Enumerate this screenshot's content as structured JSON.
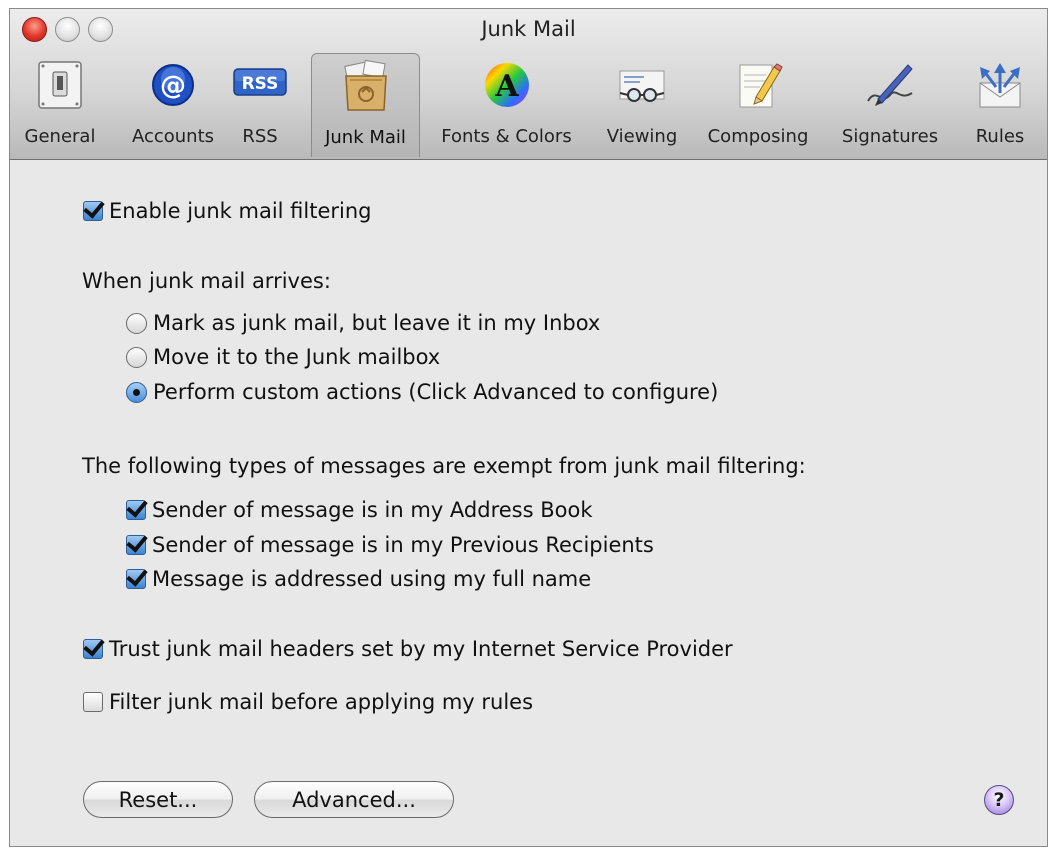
{
  "window": {
    "title": "Junk Mail"
  },
  "toolbar": {
    "items": [
      {
        "label": "General",
        "icon": "switch-icon"
      },
      {
        "label": "Accounts",
        "icon": "at-sign-icon"
      },
      {
        "label": "RSS",
        "icon": "rss-icon"
      },
      {
        "label": "Junk Mail",
        "icon": "junk-mail-bag-icon",
        "selected": true
      },
      {
        "label": "Fonts & Colors",
        "icon": "font-color-wheel-icon"
      },
      {
        "label": "Viewing",
        "icon": "glasses-envelope-icon"
      },
      {
        "label": "Composing",
        "icon": "pencil-paper-icon"
      },
      {
        "label": "Signatures",
        "icon": "pen-signature-icon"
      },
      {
        "label": "Rules",
        "icon": "rules-arrows-icon"
      }
    ],
    "rss_badge": "RSS",
    "fonts_glyph": "A",
    "accounts_glyph": "@"
  },
  "junk": {
    "enable_label": "Enable junk mail filtering",
    "enable_checked": true,
    "arrives_label": "When junk mail arrives:",
    "options": [
      {
        "label": "Mark as junk mail, but leave it in my Inbox",
        "selected": false
      },
      {
        "label": "Move it to the Junk mailbox",
        "selected": false
      },
      {
        "label": "Perform custom actions (Click Advanced to configure)",
        "selected": true
      }
    ],
    "exempt_label": "The following types of messages are exempt from junk mail filtering:",
    "exempt": [
      {
        "label": "Sender of message is in my Address Book",
        "checked": true
      },
      {
        "label": "Sender of message is in my Previous Recipients",
        "checked": true
      },
      {
        "label": "Message is addressed using my full name",
        "checked": true
      }
    ],
    "trust_label": "Trust junk mail headers set by my Internet Service Provider",
    "trust_checked": true,
    "filter_label": "Filter junk mail before applying my rules",
    "filter_checked": false
  },
  "buttons": {
    "reset": "Reset...",
    "advanced": "Advanced...",
    "help": "?"
  },
  "colors": {
    "accent": "#3c83d2",
    "close": "#e0372a",
    "help": "#8f74d6"
  }
}
